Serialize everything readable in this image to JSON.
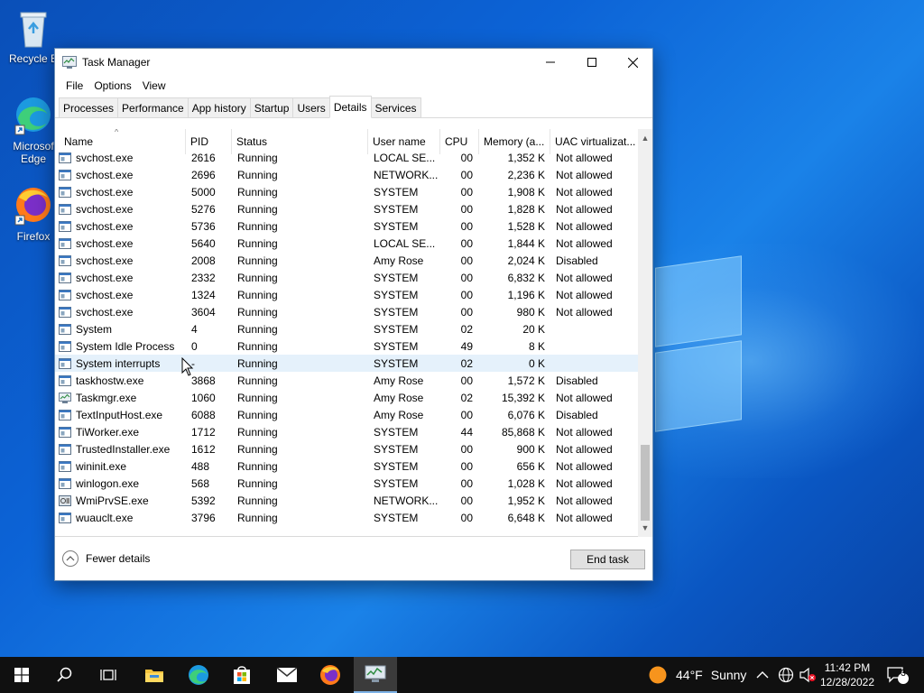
{
  "desktop": {
    "icons": [
      {
        "label": "Recycle Bin",
        "visible_label": "Recycle B"
      },
      {
        "label": "Microsoft Edge",
        "visible_label": "Microsof Edge"
      },
      {
        "label": "Firefox",
        "visible_label": "Firefox"
      }
    ]
  },
  "window": {
    "title": "Task Manager",
    "menu": [
      "File",
      "Options",
      "View"
    ],
    "tabs": [
      "Processes",
      "Performance",
      "App history",
      "Startup",
      "Users",
      "Details",
      "Services"
    ],
    "active_tab": "Details",
    "columns": [
      "Name",
      "PID",
      "Status",
      "User name",
      "CPU",
      "Memory (a...",
      "UAC virtualizat..."
    ],
    "rows": [
      {
        "name": "svchost.exe",
        "pid": "2616",
        "status": "Running",
        "user": "LOCAL SE...",
        "cpu": "00",
        "mem": "1,352 K",
        "uac": "Not allowed"
      },
      {
        "name": "svchost.exe",
        "pid": "2696",
        "status": "Running",
        "user": "NETWORK...",
        "cpu": "00",
        "mem": "2,236 K",
        "uac": "Not allowed"
      },
      {
        "name": "svchost.exe",
        "pid": "5000",
        "status": "Running",
        "user": "SYSTEM",
        "cpu": "00",
        "mem": "1,908 K",
        "uac": "Not allowed"
      },
      {
        "name": "svchost.exe",
        "pid": "5276",
        "status": "Running",
        "user": "SYSTEM",
        "cpu": "00",
        "mem": "1,828 K",
        "uac": "Not allowed"
      },
      {
        "name": "svchost.exe",
        "pid": "5736",
        "status": "Running",
        "user": "SYSTEM",
        "cpu": "00",
        "mem": "1,528 K",
        "uac": "Not allowed"
      },
      {
        "name": "svchost.exe",
        "pid": "5640",
        "status": "Running",
        "user": "LOCAL SE...",
        "cpu": "00",
        "mem": "1,844 K",
        "uac": "Not allowed"
      },
      {
        "name": "svchost.exe",
        "pid": "2008",
        "status": "Running",
        "user": "Amy Rose",
        "cpu": "00",
        "mem": "2,024 K",
        "uac": "Disabled"
      },
      {
        "name": "svchost.exe",
        "pid": "2332",
        "status": "Running",
        "user": "SYSTEM",
        "cpu": "00",
        "mem": "6,832 K",
        "uac": "Not allowed"
      },
      {
        "name": "svchost.exe",
        "pid": "1324",
        "status": "Running",
        "user": "SYSTEM",
        "cpu": "00",
        "mem": "1,196 K",
        "uac": "Not allowed"
      },
      {
        "name": "svchost.exe",
        "pid": "3604",
        "status": "Running",
        "user": "SYSTEM",
        "cpu": "00",
        "mem": "980 K",
        "uac": "Not allowed"
      },
      {
        "name": "System",
        "pid": "4",
        "status": "Running",
        "user": "SYSTEM",
        "cpu": "02",
        "mem": "20 K",
        "uac": ""
      },
      {
        "name": "System Idle Process",
        "pid": "0",
        "status": "Running",
        "user": "SYSTEM",
        "cpu": "49",
        "mem": "8 K",
        "uac": ""
      },
      {
        "name": "System interrupts",
        "pid": "-",
        "status": "Running",
        "user": "SYSTEM",
        "cpu": "02",
        "mem": "0 K",
        "uac": ""
      },
      {
        "name": "taskhostw.exe",
        "pid": "3868",
        "status": "Running",
        "user": "Amy Rose",
        "cpu": "00",
        "mem": "1,572 K",
        "uac": "Disabled"
      },
      {
        "name": "Taskmgr.exe",
        "pid": "1060",
        "status": "Running",
        "user": "Amy Rose",
        "cpu": "02",
        "mem": "15,392 K",
        "uac": "Not allowed"
      },
      {
        "name": "TextInputHost.exe",
        "pid": "6088",
        "status": "Running",
        "user": "Amy Rose",
        "cpu": "00",
        "mem": "6,076 K",
        "uac": "Disabled"
      },
      {
        "name": "TiWorker.exe",
        "pid": "1712",
        "status": "Running",
        "user": "SYSTEM",
        "cpu": "44",
        "mem": "85,868 K",
        "uac": "Not allowed"
      },
      {
        "name": "TrustedInstaller.exe",
        "pid": "1612",
        "status": "Running",
        "user": "SYSTEM",
        "cpu": "00",
        "mem": "900 K",
        "uac": "Not allowed"
      },
      {
        "name": "wininit.exe",
        "pid": "488",
        "status": "Running",
        "user": "SYSTEM",
        "cpu": "00",
        "mem": "656 K",
        "uac": "Not allowed"
      },
      {
        "name": "winlogon.exe",
        "pid": "568",
        "status": "Running",
        "user": "SYSTEM",
        "cpu": "00",
        "mem": "1,028 K",
        "uac": "Not allowed"
      },
      {
        "name": "WmiPrvSE.exe",
        "pid": "5392",
        "status": "Running",
        "user": "NETWORK...",
        "cpu": "00",
        "mem": "1,952 K",
        "uac": "Not allowed"
      },
      {
        "name": "wuauclt.exe",
        "pid": "3796",
        "status": "Running",
        "user": "SYSTEM",
        "cpu": "00",
        "mem": "6,648 K",
        "uac": "Not allowed"
      }
    ],
    "footer": {
      "fewer_details": "Fewer details",
      "end_task": "End task"
    }
  },
  "taskbar": {
    "weather_temp": "44°F",
    "weather_cond": "Sunny",
    "time": "11:42 PM",
    "date": "12/28/2022",
    "notification_count": "3"
  },
  "colors": {
    "accent": "#0078d7",
    "row_hover": "#e5f1fb",
    "taskbar": "#101010"
  }
}
